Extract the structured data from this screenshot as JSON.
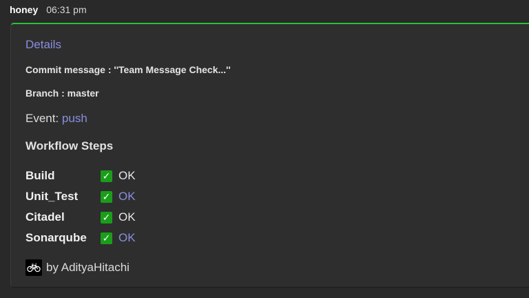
{
  "message": {
    "sender": "honey",
    "time": "06:31 pm"
  },
  "card": {
    "accent_color": "#29c42f",
    "title": "Details",
    "commit_message": "Commit message : ''Team Message Check...''",
    "branch": "Branch : master",
    "event_label": "Event: ",
    "event_value": "push",
    "workflow_title": "Workflow Steps",
    "steps": [
      {
        "name": "Build",
        "check": "✓",
        "status": "OK",
        "status_is_link": false
      },
      {
        "name": "Unit_Test",
        "check": "✓",
        "status": "OK",
        "status_is_link": true
      },
      {
        "name": "Citadel",
        "check": "✓",
        "status": "OK",
        "status_is_link": false
      },
      {
        "name": "Sonarqube",
        "check": "✓",
        "status": "OK",
        "status_is_link": true
      }
    ],
    "footer": {
      "avatar_icon": "bicycle-icon",
      "text": "by AdityaHitachi"
    }
  }
}
